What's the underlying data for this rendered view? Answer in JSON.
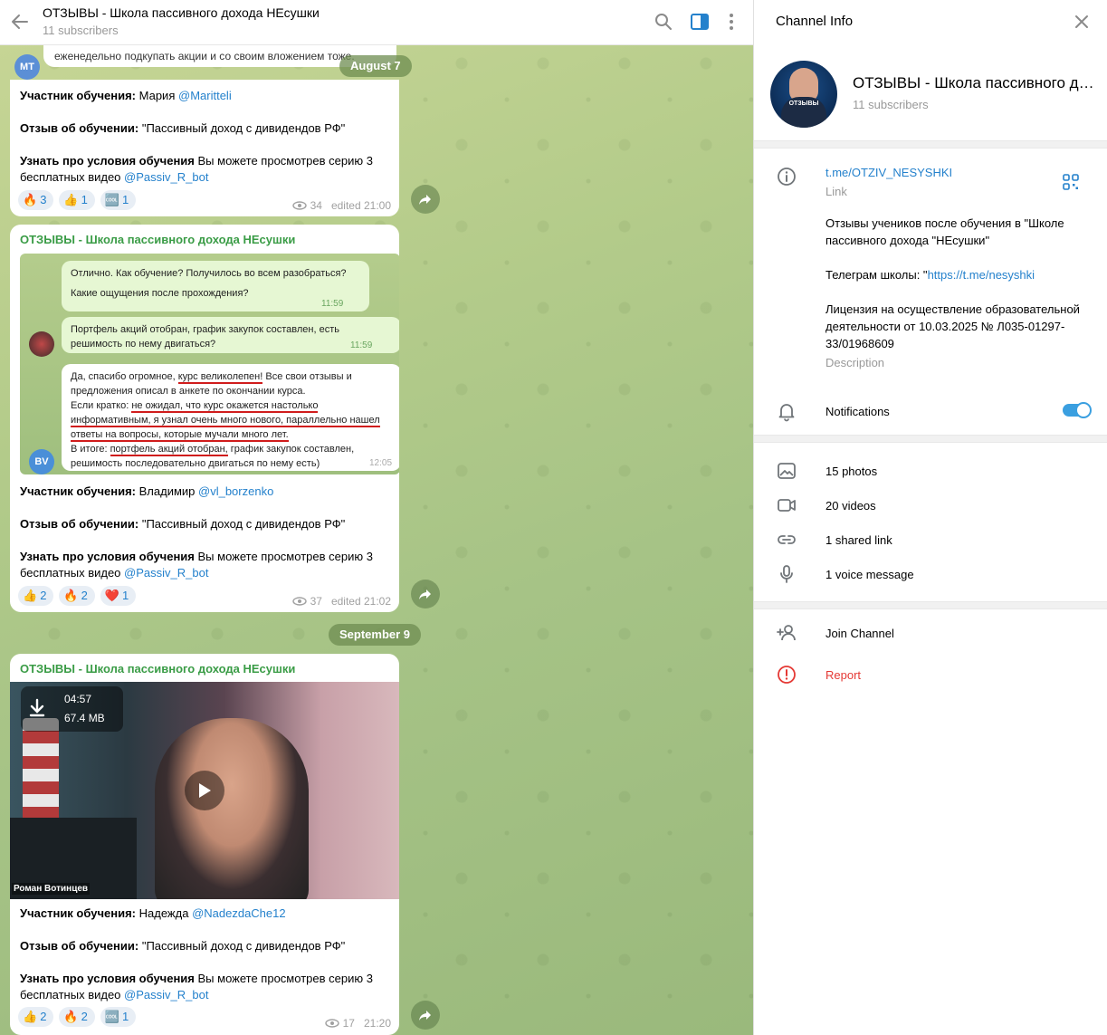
{
  "header": {
    "title": "ОТЗЫВЫ - Школа пассивного дохода НЕсушки",
    "subscribers": "11 subscribers"
  },
  "chat": {
    "date_aug": "August 7",
    "date_sep": "September 9",
    "top_snippet": "еженедельно подкупать акции и со своим вложением тоже.",
    "top_avatar": "MT",
    "msg1": {
      "participant_label": "Участник обучения:",
      "participant_name": "Мария",
      "participant_handle": "@Maritteli",
      "review_label": "Отзыв об обучении:",
      "review_value": "\"Пассивный доход с дивидендов РФ\"",
      "learn_label": "Узнать про условия обучения",
      "learn_text": "Вы можете просмотрев серию 3 бесплатных видео",
      "bot": "@Passiv_R_bot",
      "reactions": [
        {
          "emoji": "🔥",
          "count": "3"
        },
        {
          "emoji": "👍",
          "count": "1"
        },
        {
          "emoji": "🆒",
          "count": "1"
        }
      ],
      "views": "34",
      "time": "edited 21:00"
    },
    "msg2": {
      "sender": "ОТЗЫВЫ - Школа пассивного дохода НЕсушки",
      "shot_q1": "Отлично. Как обучение? Получилось во всем разобраться?",
      "shot_q2": "Какие ощущения после прохождения?",
      "shot_t1": "11:59",
      "shot_q3": "Портфель акций отобран, график закупок составлен, есть решимость по нему двигаться?",
      "shot_t2": "11:59",
      "shot_a1": "Да, спасибо огромное, ",
      "shot_a1u": "курс великолепен!",
      "shot_a2": " Все свои отзывы и предложения описал в анкете по окончании курса.",
      "shot_a3": "Если кратко: ",
      "shot_a3u": "не ожидал, что курс окажется настолько информативным,",
      "shot_a4u": " я узнал очень много нового, параллельно нашел ответы на вопросы, которые мучали много лет.",
      "shot_a5": "В итоге: ",
      "shot_a5u": "портфель акций отобран,",
      "shot_a6": " график закупок составлен, решимость последовательно двигаться по нему есть)",
      "shot_t3": "12:05",
      "avatar": "BV",
      "participant_label": "Участник обучения:",
      "participant_name": "Владимир",
      "participant_handle": "@vl_borzenko",
      "review_label": "Отзыв об обучении:",
      "review_value": "\"Пассивный доход с дивидендов РФ\"",
      "learn_label": "Узнать про условия обучения",
      "learn_text": "Вы можете просмотрев серию 3 бесплатных видео",
      "bot": "@Passiv_R_bot",
      "reactions": [
        {
          "emoji": "👍",
          "count": "2"
        },
        {
          "emoji": "🔥",
          "count": "2"
        },
        {
          "emoji": "❤️",
          "count": "1"
        }
      ],
      "views": "37",
      "time": "edited 21:02"
    },
    "msg3": {
      "sender": "ОТЗЫВЫ - Школа пассивного дохода НЕсушки",
      "video_duration": "04:57",
      "video_size": "67.4 MB",
      "video_caption": "Роман Вотинцев",
      "participant_label": "Участник обучения:",
      "participant_name": "Надежда",
      "participant_handle": "@NadezdaChe12",
      "review_label": "Отзыв об обучении:",
      "review_value": "\"Пассивный доход с дивидендов РФ\"",
      "learn_label": "Узнать про условия обучения",
      "learn_text": "Вы можете просмотрев серию 3 бесплатных видео",
      "bot": "@Passiv_R_bot",
      "reactions": [
        {
          "emoji": "👍",
          "count": "2"
        },
        {
          "emoji": "🔥",
          "count": "2"
        },
        {
          "emoji": "🆒",
          "count": "1"
        }
      ],
      "views": "17",
      "time": "21:20"
    }
  },
  "side": {
    "title": "Channel Info",
    "channel_name": "ОТЗЫВЫ - Школа пассивного дохода НЕсушки",
    "subscribers": "11 subscribers",
    "avatar_label": "ОТЗЫВЫ",
    "link": "t.me/OTZIV_NESYSHKI",
    "link_label": "Link",
    "desc_p1": "Отзывы учеников после обучения в \"Школе пассивного дохода \"НЕсушки\"",
    "desc_p2_prefix": "Телеграм школы: \"",
    "desc_p2_link": "https://t.me/nesyshki",
    "desc_p3": "Лицензия на осуществление образовательной деятельности от 10.03.2025 № Л035-01297-33/01968609",
    "desc_label": "Description",
    "notifications": "Notifications",
    "notifications_on": true,
    "photos": "15 photos",
    "videos": "20 videos",
    "shared_links": "1 shared link",
    "voice": "1 voice message",
    "join": "Join Channel",
    "report": "Report"
  },
  "colors": {
    "accent": "#2481cc",
    "sender_green": "#3a9c46",
    "report_red": "#e53935",
    "toggle": "#3a9fe0"
  }
}
